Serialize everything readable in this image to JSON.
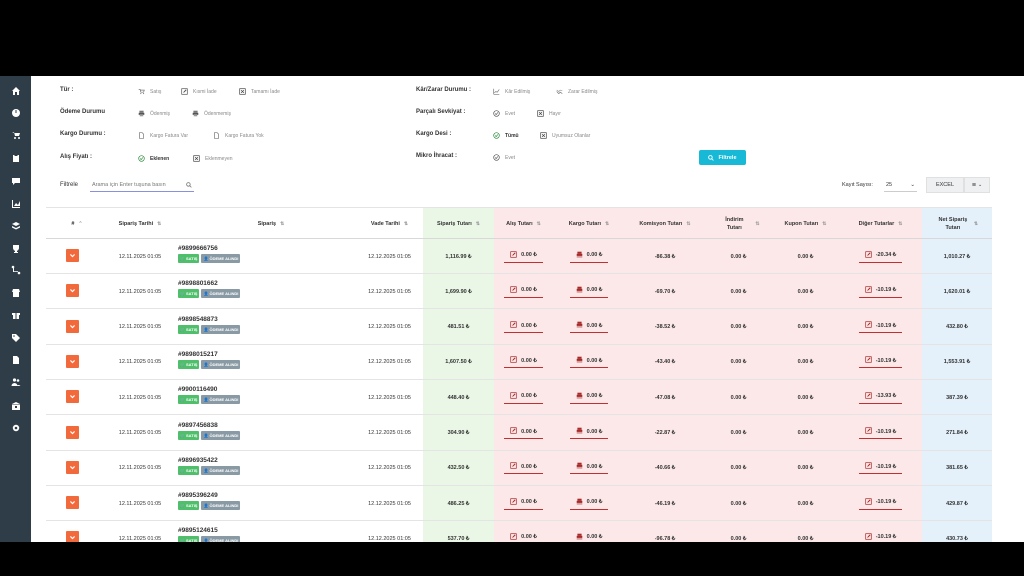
{
  "sidebar": {
    "icons": [
      "home-icon",
      "dashboard-icon",
      "cart-icon",
      "clipboard-icon",
      "chat-icon",
      "chart-icon",
      "layers-icon",
      "trophy-icon",
      "routes-icon",
      "store-icon",
      "gift-icon",
      "tags-icon",
      "file-icon",
      "users-icon",
      "bank-icon",
      "gear-icon"
    ]
  },
  "filters": {
    "tur": {
      "label": "Tür :",
      "options": [
        "Satış",
        "Kısmi İade",
        "Tamamı İade"
      ]
    },
    "odeme": {
      "label": "Ödeme Durumu",
      "options": [
        "Ödenmiş",
        "Ödenmemiş"
      ]
    },
    "kargo": {
      "label": "Kargo Durumu :",
      "options": [
        "Kargo Fatura Var",
        "Kargo Fatura Yok"
      ]
    },
    "alis": {
      "label": "Alış Fiyatı :",
      "options": [
        "Eklenen",
        "Eklenmeyen"
      ]
    },
    "kar": {
      "label": "Kâr/Zarar Durumu :",
      "options": [
        "Kâr Edilmiş",
        "Zarar Edilmiş"
      ]
    },
    "parcali": {
      "label": "Parçalı Sevkiyat :",
      "options": [
        "Evet",
        "Hayır"
      ]
    },
    "desi": {
      "label": "Kargo Desi :",
      "options": [
        "Tümü",
        "Uyumsuz Olanlar"
      ]
    },
    "mikro": {
      "label": "Mikro İhracat :",
      "options": [
        "Evet"
      ]
    },
    "filter_button": "Filtrele"
  },
  "search": {
    "label": "Filtrele",
    "placeholder": "Arama için Enter tuşuna basın"
  },
  "records": {
    "label": "Kayıt Sayısı:",
    "value": "25"
  },
  "excel_button": "EXCEL",
  "columns": [
    "#",
    "Sipariş Tarihi",
    "Sipariş",
    "Vade Tarihi",
    "Sipariş Tutarı",
    "Alış Tutarı",
    "Kargo Tutarı",
    "Komisyon Tutarı",
    "İndirim Tutarı",
    "Kupon Tutarı",
    "Diğer Tutarlar",
    "Net Sipariş Tutarı"
  ],
  "badges": {
    "sale": "SATIŞ",
    "paid": "ÖDEME ALINDI"
  },
  "rows": [
    {
      "date": "12.11.2025 01:05",
      "order": "#9899666756",
      "due": "12.12.2025 01:05",
      "amount": "1,116.99 ₺",
      "purchase": "0.00 ₺",
      "cargo": "0.00 ₺",
      "commission": "-86.38 ₺",
      "discount": "0.00 ₺",
      "coupon": "0.00 ₺",
      "other": "-20.34 ₺",
      "net": "1,010.27 ₺"
    },
    {
      "date": "12.11.2025 01:05",
      "order": "#9898801662",
      "due": "12.12.2025 01:05",
      "amount": "1,699.90 ₺",
      "purchase": "0.00 ₺",
      "cargo": "0.00 ₺",
      "commission": "-69.70 ₺",
      "discount": "0.00 ₺",
      "coupon": "0.00 ₺",
      "other": "-10.19 ₺",
      "net": "1,620.01 ₺"
    },
    {
      "date": "12.11.2025 01:05",
      "order": "#9898548873",
      "due": "12.12.2025 01:05",
      "amount": "481.51 ₺",
      "purchase": "0.00 ₺",
      "cargo": "0.00 ₺",
      "commission": "-38.52 ₺",
      "discount": "0.00 ₺",
      "coupon": "0.00 ₺",
      "other": "-10.19 ₺",
      "net": "432.80 ₺"
    },
    {
      "date": "12.11.2025 01:05",
      "order": "#9898015217",
      "due": "12.12.2025 01:05",
      "amount": "1,607.50 ₺",
      "purchase": "0.00 ₺",
      "cargo": "0.00 ₺",
      "commission": "-43.40 ₺",
      "discount": "0.00 ₺",
      "coupon": "0.00 ₺",
      "other": "-10.19 ₺",
      "net": "1,553.91 ₺"
    },
    {
      "date": "12.11.2025 01:05",
      "order": "#9900116490",
      "due": "12.12.2025 01:05",
      "amount": "448.40 ₺",
      "purchase": "0.00 ₺",
      "cargo": "0.00 ₺",
      "commission": "-47.08 ₺",
      "discount": "0.00 ₺",
      "coupon": "0.00 ₺",
      "other": "-13.93 ₺",
      "net": "387.39 ₺"
    },
    {
      "date": "12.11.2025 01:05",
      "order": "#9897456838",
      "due": "12.12.2025 01:05",
      "amount": "304.90 ₺",
      "purchase": "0.00 ₺",
      "cargo": "0.00 ₺",
      "commission": "-22.87 ₺",
      "discount": "0.00 ₺",
      "coupon": "0.00 ₺",
      "other": "-10.19 ₺",
      "net": "271.84 ₺"
    },
    {
      "date": "12.11.2025 01:05",
      "order": "#9896935422",
      "due": "12.12.2025 01:05",
      "amount": "432.50 ₺",
      "purchase": "0.00 ₺",
      "cargo": "0.00 ₺",
      "commission": "-40.66 ₺",
      "discount": "0.00 ₺",
      "coupon": "0.00 ₺",
      "other": "-10.19 ₺",
      "net": "381.65 ₺"
    },
    {
      "date": "12.11.2025 01:05",
      "order": "#9895396249",
      "due": "12.12.2025 01:05",
      "amount": "486.25 ₺",
      "purchase": "0.00 ₺",
      "cargo": "0.00 ₺",
      "commission": "-46.19 ₺",
      "discount": "0.00 ₺",
      "coupon": "0.00 ₺",
      "other": "-10.19 ₺",
      "net": "429.87 ₺"
    },
    {
      "date": "12.11.2025 01:05",
      "order": "#9895124615",
      "due": "12.12.2025 01:05",
      "amount": "537.70 ₺",
      "purchase": "0.00 ₺",
      "cargo": "0.00 ₺",
      "commission": "-96.78 ₺",
      "discount": "0.00 ₺",
      "coupon": "0.00 ₺",
      "other": "-10.19 ₺",
      "net": "430.73 ₺"
    }
  ],
  "colors": {
    "sidebar": "#2f3d48",
    "accent_orange": "#f26a3b",
    "filter_button": "#17b9d6",
    "green_col": "#eaf6e6",
    "red_col": "#fce8e8",
    "blue_col": "#e4f1fb"
  }
}
